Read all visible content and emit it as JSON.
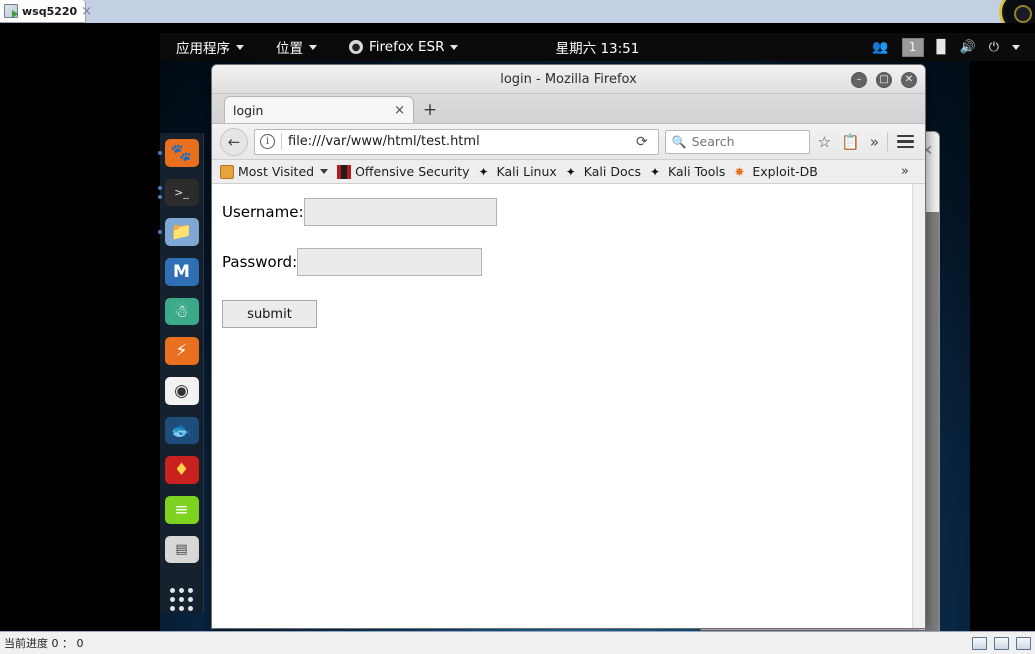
{
  "host": {
    "tab_label": "wsq5220",
    "tab_close": "×",
    "status_text": "当前进度 0 ： 0"
  },
  "panel": {
    "applications": "应用程序",
    "places": "位置",
    "firefox": "Firefox ESR",
    "clock": "星期六 13:51",
    "workspace": "1",
    "tray": {
      "users_icon": "users-icon",
      "network_icon": "network-icon",
      "volume_icon": "volume-icon",
      "power_icon": "power-icon",
      "chevron_icon": "chevron-down-icon"
    }
  },
  "dock": {
    "items": [
      {
        "name": "firefox",
        "glyph": "🦊",
        "bg": "#e8701f",
        "running": true
      },
      {
        "name": "terminal",
        "glyph": "⬛",
        "bg": "#2c2c2c",
        "running": true
      },
      {
        "name": "files",
        "glyph": "📁",
        "bg": "#7fa8d4",
        "running": true
      },
      {
        "name": "metasploit",
        "glyph": "M",
        "bg": "#2f6fb5",
        "running": false
      },
      {
        "name": "armitage",
        "glyph": "🧝",
        "bg": "#3ba98a",
        "running": false
      },
      {
        "name": "burpsuite",
        "glyph": "⚡",
        "bg": "#e8701f",
        "running": false
      },
      {
        "name": "beef",
        "glyph": "◉",
        "bg": "#f2f2f2",
        "running": false
      },
      {
        "name": "wireshark",
        "glyph": "🐟",
        "bg": "#1e4d7b",
        "running": false
      },
      {
        "name": "john-the-ripper",
        "glyph": "🔥",
        "bg": "#c8211f",
        "running": false
      },
      {
        "name": "text-editor",
        "glyph": "≡",
        "bg": "#7ed321",
        "running": false
      },
      {
        "name": "calculator",
        "glyph": "⌨",
        "bg": "#d8d8d8",
        "running": false
      }
    ],
    "app_grid": "show-applications"
  },
  "firefox": {
    "window_title": "login - Mozilla Firefox",
    "window_buttons": {
      "minimize": "–",
      "maximize": "□",
      "close": "✕"
    },
    "tab": {
      "label": "login",
      "close": "×"
    },
    "new_tab": "+",
    "nav": {
      "back": "←",
      "identity_icon": "i",
      "url": "file:///var/www/html/test.html",
      "reload": "⟳",
      "search_placeholder": "Search",
      "search_value": "",
      "bookmark_star": "☆",
      "library_icon": "🗂",
      "overflow": "»"
    },
    "bookmarks": [
      {
        "label": "Most Visited",
        "icon": "most-visited-icon",
        "color": "#e8a33d",
        "has_chevron": true
      },
      {
        "label": "Offensive Security",
        "icon": "offensive-security-icon",
        "color": "#b71c1c",
        "has_chevron": false
      },
      {
        "label": "Kali Linux",
        "icon": "kali-icon",
        "color": "#1f1f1f",
        "has_chevron": false
      },
      {
        "label": "Kali Docs",
        "icon": "kali-icon",
        "color": "#1f1f1f",
        "has_chevron": false
      },
      {
        "label": "Kali Tools",
        "icon": "kali-icon",
        "color": "#1f1f1f",
        "has_chevron": false
      },
      {
        "label": "Exploit-DB",
        "icon": "exploit-db-icon",
        "color": "#e8701f",
        "has_chevron": false
      }
    ],
    "bookmarks_overflow": "»"
  },
  "page": {
    "username_label": "Username:",
    "username_value": "",
    "password_label": "Password:",
    "password_value": "",
    "submit_label": "submit"
  },
  "background_window": {
    "close": "✕"
  }
}
